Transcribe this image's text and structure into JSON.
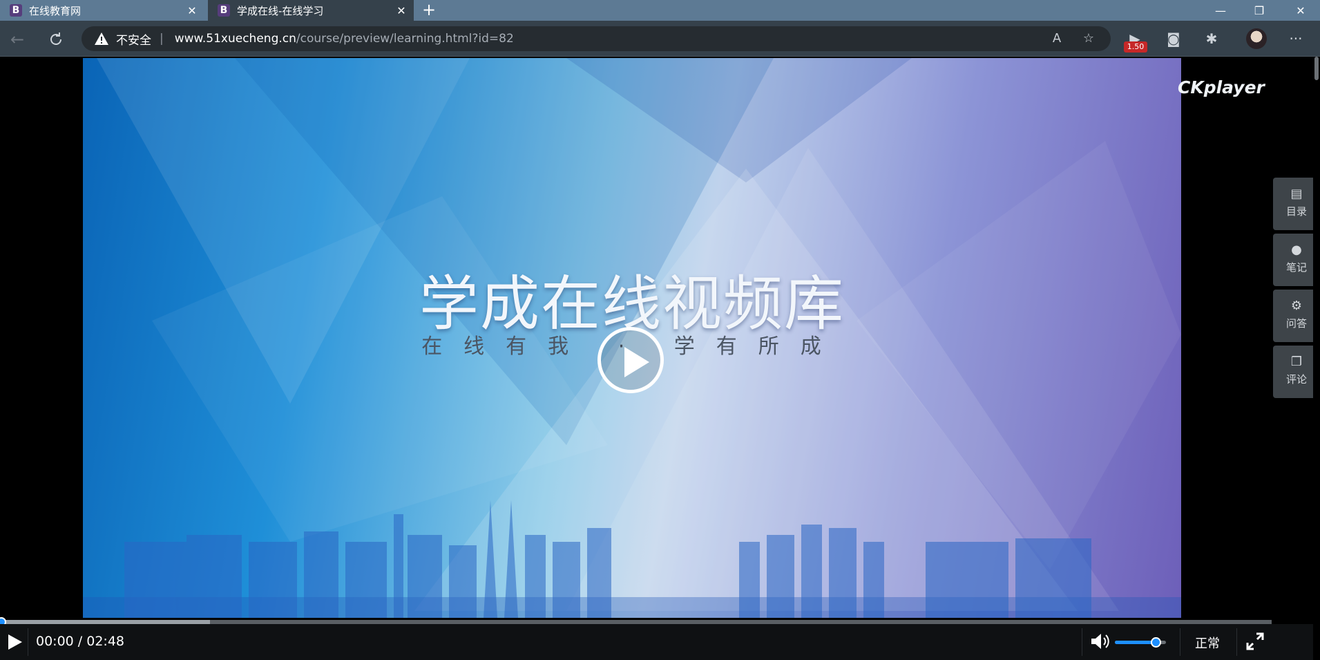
{
  "browser": {
    "tabs": [
      {
        "favicon": "B",
        "title": "在线教育网",
        "active": false
      },
      {
        "favicon": "B",
        "title": "学成在线-在线学习",
        "active": true
      }
    ],
    "new_tab_icon": "plus-icon",
    "window_controls": {
      "minimize": "—",
      "restore": "❐",
      "close": "✕"
    },
    "address": {
      "security_label": "不安全",
      "separator": "|",
      "host": "www.51xuecheng.cn",
      "path": "/course/preview/learning.html?id=82"
    },
    "extension_badge": "1.50",
    "more_icon": "···"
  },
  "video": {
    "brand_title": "学成在线视频库",
    "slogan": "在线有我 · 学有所成",
    "player_watermark": "CKplayer"
  },
  "sidebar": {
    "items": [
      {
        "label": "目录",
        "icon": "catalog-icon"
      },
      {
        "label": "笔记",
        "icon": "user-icon"
      },
      {
        "label": "问答",
        "icon": "gear-icon"
      },
      {
        "label": "评论",
        "icon": "copy-icon"
      }
    ]
  },
  "controls": {
    "current_time": "00:00",
    "duration": "02:48",
    "time_display": "00:00 / 02:48",
    "played_fraction": 0.0,
    "buffered_fraction": 0.165,
    "volume_fraction": 0.8,
    "quality_label": "正常"
  },
  "colors": {
    "accent": "#1e90ff",
    "tab_active_bg": "#35414b",
    "tab_bar_bg": "#5d7a94",
    "control_bar_bg": "#0f1113"
  }
}
